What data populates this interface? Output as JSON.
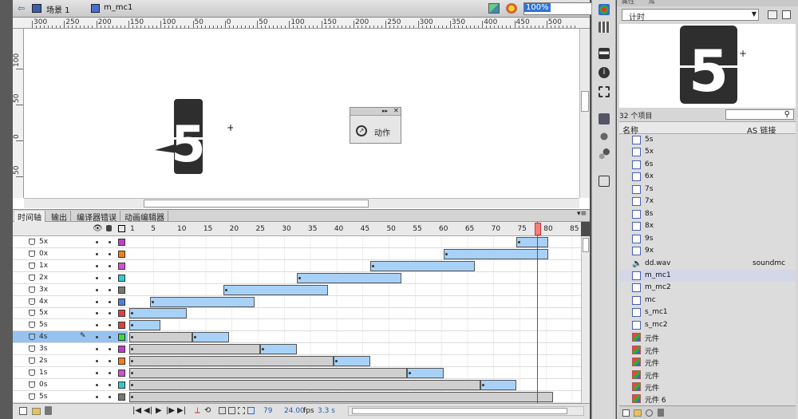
{
  "breadcrumb": {
    "scene": "场景 1",
    "symbol": "m_mc1"
  },
  "zoom": "100%",
  "ruler": {
    "h_ticks": [
      "300",
      "250",
      "200",
      "150",
      "100",
      "50",
      "0",
      "50",
      "100",
      "150",
      "200",
      "250",
      "300",
      "350",
      "400",
      "450",
      "500"
    ],
    "v_ticks": [
      "100",
      "50",
      "0",
      "50"
    ]
  },
  "stage": {
    "logo_digit": "5"
  },
  "actions_panel": {
    "label": "动作"
  },
  "timeline": {
    "tabs": [
      "时间轴",
      "输出",
      "编译器错误",
      "动画编辑器"
    ],
    "frame_numbers": [
      "1",
      "5",
      "10",
      "15",
      "20",
      "25",
      "30",
      "35",
      "40",
      "45",
      "50",
      "55",
      "60",
      "65",
      "70",
      "75",
      "80",
      "85"
    ],
    "layers": [
      {
        "name": "5x",
        "color": "#c33ccc"
      },
      {
        "name": "0x",
        "color": "#f07f17"
      },
      {
        "name": "1x",
        "color": "#d44fd4"
      },
      {
        "name": "2x",
        "color": "#33cccc"
      },
      {
        "name": "3x",
        "color": "#777777"
      },
      {
        "name": "4x",
        "color": "#4f80e0"
      },
      {
        "name": "5x",
        "color": "#e04040"
      },
      {
        "name": "5s",
        "color": "#e04040"
      },
      {
        "name": "4s",
        "color": "#33dd44"
      },
      {
        "name": "3s",
        "color": "#c33ccc"
      },
      {
        "name": "2s",
        "color": "#f07f17"
      },
      {
        "name": "1s",
        "color": "#d44fd4"
      },
      {
        "name": "0s",
        "color": "#33cccc"
      },
      {
        "name": "5s",
        "color": "#777777"
      }
    ],
    "status": {
      "frame": "79",
      "fps": "24.00",
      "fps_unit": "fps",
      "time": "3.3 s"
    },
    "current_frame": 80
  },
  "library": {
    "tabs": [
      "属性",
      "库"
    ],
    "dropdown": "计时",
    "preview_digit": "5",
    "item_count": "32 个项目",
    "columns": {
      "name": "名称",
      "linkage": "AS 链接"
    },
    "items": [
      {
        "name": "5s",
        "type": "mc"
      },
      {
        "name": "5x",
        "type": "mc"
      },
      {
        "name": "6s",
        "type": "mc"
      },
      {
        "name": "6x",
        "type": "mc"
      },
      {
        "name": "7s",
        "type": "mc"
      },
      {
        "name": "7x",
        "type": "mc"
      },
      {
        "name": "8s",
        "type": "mc"
      },
      {
        "name": "8x",
        "type": "mc"
      },
      {
        "name": "9s",
        "type": "mc"
      },
      {
        "name": "9x",
        "type": "mc"
      },
      {
        "name": "dd.wav",
        "type": "sound",
        "linkage": "soundmc"
      },
      {
        "name": "m_mc1",
        "type": "mc",
        "selected": true
      },
      {
        "name": "m_mc2",
        "type": "mc"
      },
      {
        "name": "mc",
        "type": "mc"
      },
      {
        "name": "s_mc1",
        "type": "mc"
      },
      {
        "name": "s_mc2",
        "type": "mc"
      },
      {
        "name": "元件",
        "type": "gfx"
      },
      {
        "name": "元件",
        "type": "gfx"
      },
      {
        "name": "元件",
        "type": "gfx"
      },
      {
        "name": "元件",
        "type": "gfx"
      },
      {
        "name": "元件",
        "type": "gfx"
      },
      {
        "name": "元件 6",
        "type": "gfx"
      }
    ]
  },
  "colors": {
    "accent": "#3074d6",
    "tween_blue": "#a8d1f7",
    "tween_gray": "#cfcfcf",
    "playhead": "#e02020"
  }
}
